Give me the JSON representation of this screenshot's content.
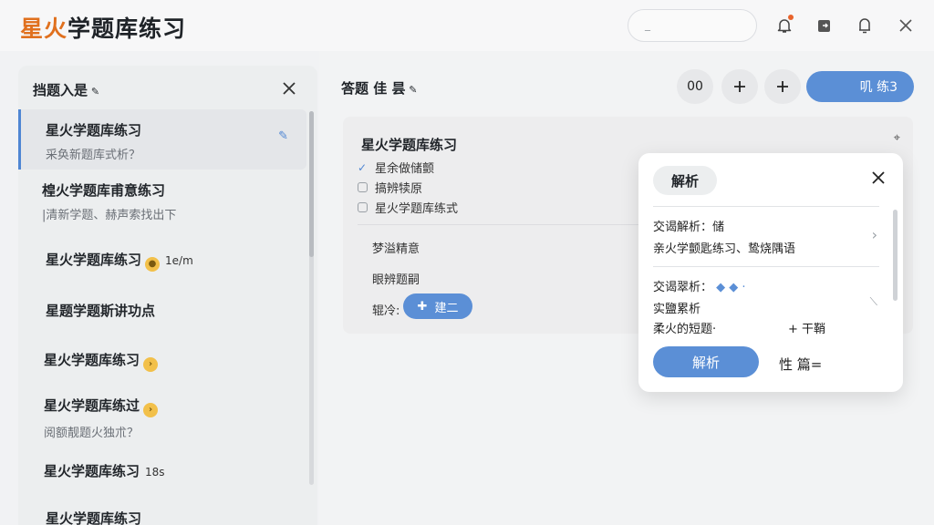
{
  "app": {
    "title_accent": "星火",
    "title_rest": "学题库练习"
  },
  "topbar": {
    "search_placeholder": "_"
  },
  "left_panel": {
    "title": "挡题入是",
    "items": [
      {
        "title": "星火学题库练习",
        "sub": "采奂新题库式析？",
        "selected": true
      },
      {
        "title": "楻火学题库甫意练习",
        "sub": "|清新学题、赫声索找出下"
      },
      {
        "title": "星火学题库练习",
        "meta": "1e/m",
        "badge": true
      },
      {
        "title": "星题学题斯讲功点",
        "sub": ""
      },
      {
        "title": "星火学题库练习",
        "badge": true
      },
      {
        "title": "星火学题库练过",
        "sub": "阅额靓题火独朮？",
        "badge": true
      },
      {
        "title": "星火学题库练习",
        "meta": "18s"
      },
      {
        "title": "星火学题库练习"
      }
    ]
  },
  "header": {
    "title": "答题 佳 昙",
    "btn_count": "00",
    "primary_label": "叽 练3"
  },
  "card": {
    "title": "星火学题库练习",
    "options": [
      {
        "label": "星余做储颤",
        "checked": true
      },
      {
        "label": "搞辨犊原",
        "checked": false
      },
      {
        "label": "星火学题库练式",
        "checked": false
      }
    ],
    "row1": "梦溢精意",
    "row2": "眼辨题嗣",
    "row3_label": "辊冷:",
    "tag_label": "建二"
  },
  "popover": {
    "chip": "解析",
    "line1": "交谒解析：储",
    "line2": "亲火学颤匙练习、鸷烧隅语",
    "line3": "交谒翠析：",
    "line4": "实鹽累析",
    "line5": "柔火的短题·",
    "line5_right": "+ 干鞘",
    "primary_btn": "解析",
    "secondary": "性 篇="
  }
}
